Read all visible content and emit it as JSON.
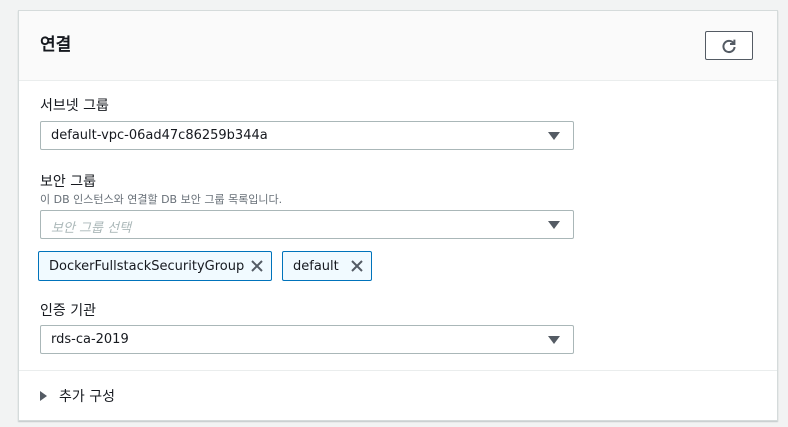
{
  "connectivity": {
    "title": "연결",
    "refresh_icon": "refresh-icon"
  },
  "subnet_group": {
    "label": "서브넷 그룹",
    "value": "default-vpc-06ad47c86259b344a"
  },
  "security_group": {
    "label": "보안 그룹",
    "description": "이 DB 인스턴스와 연결할 DB 보안 그룹 목록입니다.",
    "placeholder": "보안 그룹 선택",
    "tokens": [
      {
        "label": "DockerFullstackSecurityGroup"
      },
      {
        "label": "default"
      }
    ]
  },
  "certificate_authority": {
    "label": "인증 기관",
    "value": "rds-ca-2019"
  },
  "additional_config": {
    "label": "추가 구성"
  },
  "colors": {
    "accent": "#0073bb",
    "token_bg": "#f1faff",
    "border": "#aab7b8",
    "text": "#16191f"
  }
}
